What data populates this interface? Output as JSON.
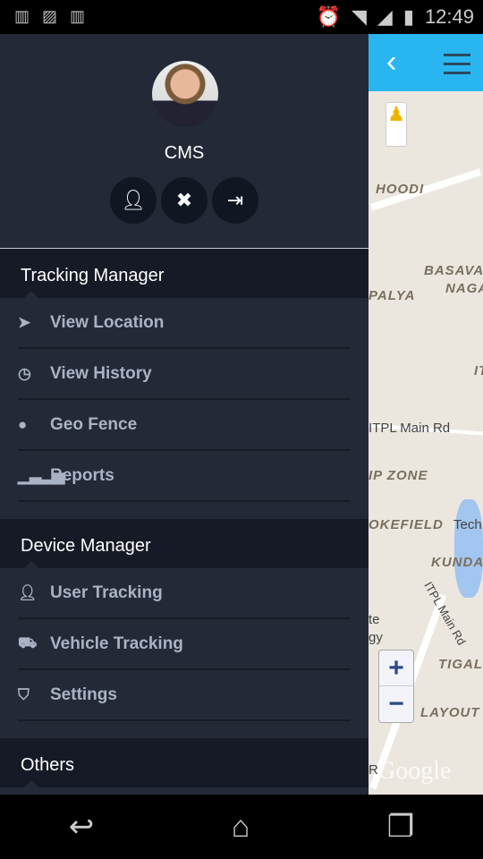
{
  "status_bar": {
    "time": "12:49",
    "icons": [
      "barcode-icon",
      "image-icon",
      "barcode-icon",
      "alarm-icon",
      "wifi-icon",
      "signal-icon",
      "battery-charging-icon"
    ]
  },
  "profile": {
    "name": "CMS",
    "actions": [
      "profile-icon",
      "tools-icon",
      "logout-icon"
    ]
  },
  "sections": [
    {
      "title": "Tracking Manager",
      "items": [
        {
          "label": "View Location",
          "icon": "navigation-arrow-icon"
        },
        {
          "label": "View History",
          "icon": "clock-icon"
        },
        {
          "label": "Geo Fence",
          "icon": "map-pin-icon"
        },
        {
          "label": "Reports",
          "icon": "bar-chart-icon"
        }
      ]
    },
    {
      "title": "Device Manager",
      "items": [
        {
          "label": "User Tracking",
          "icon": "user-icon"
        },
        {
          "label": "Vehicle Tracking",
          "icon": "truck-icon"
        },
        {
          "label": "Settings",
          "icon": "shield-icon"
        }
      ]
    },
    {
      "title": "Others",
      "items": []
    }
  ],
  "map": {
    "labels": [
      "HOODI",
      "BASAVA",
      "NAGA",
      "PALYA",
      "IT",
      "ITPL Main Rd",
      "IP ZONE",
      "OKEFIELD",
      "Tech",
      "KUNDAL",
      "ITPL Main Rd",
      "te",
      "gy",
      "TIGALA",
      "LAYOUT",
      "R"
    ],
    "zoom_in": "+",
    "zoom_out": "−",
    "attribution": "Google",
    "accent": "#29b6f0"
  },
  "colors": {
    "drawer_bg": "#232936",
    "section_bg": "#151a26",
    "item_text": "#a9b3c5"
  }
}
